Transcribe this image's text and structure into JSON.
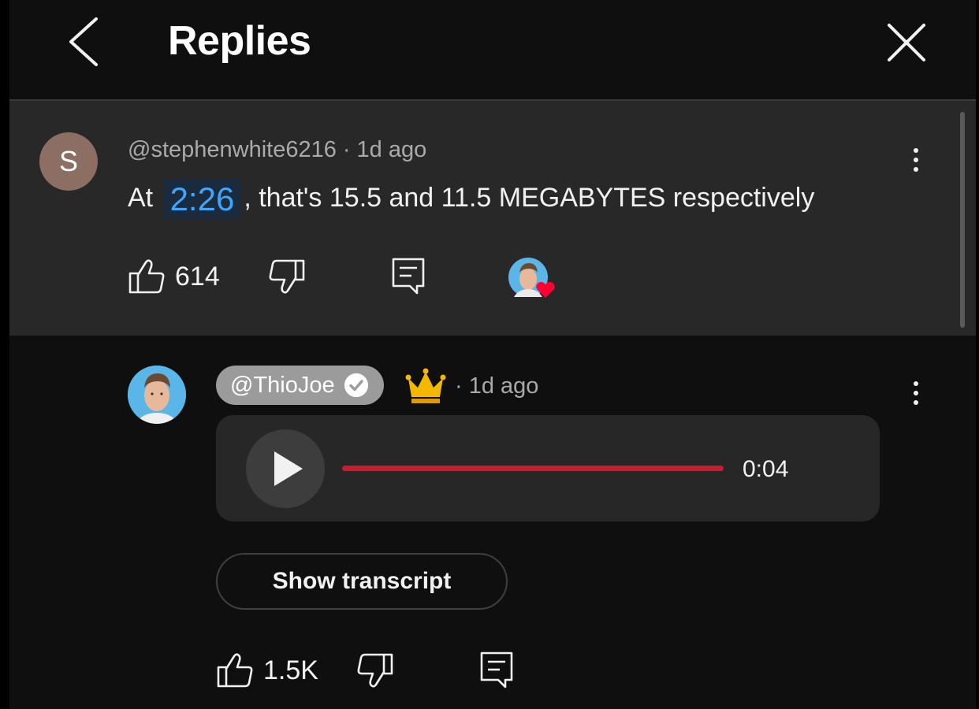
{
  "header": {
    "title": "Replies",
    "back_icon": "chevron-left-icon",
    "close_icon": "close-icon"
  },
  "parent_comment": {
    "avatar_letter": "S",
    "avatar_color": "#8d6e63",
    "handle": "@stephenwhite6216",
    "separator": "·",
    "time": "1d ago",
    "text_prefix": "At",
    "timestamp_link": "2:26",
    "text_suffix": ", that's 15.5 and 11.5 MEGABYTES respectively",
    "likes": "614",
    "creator_heart": true
  },
  "reply": {
    "handle": "@ThioJoe",
    "verified": true,
    "badge_icon": "crown-icon",
    "separator": "·",
    "time": "1d ago",
    "audio": {
      "duration": "0:04",
      "progress_color": "#cc1a2e"
    },
    "transcript_button": "Show transcript",
    "likes": "1.5K"
  },
  "colors": {
    "background": "#0f0f0f",
    "highlight": "#282828",
    "link": "#3ea6ff",
    "heart": "#ff0033"
  }
}
